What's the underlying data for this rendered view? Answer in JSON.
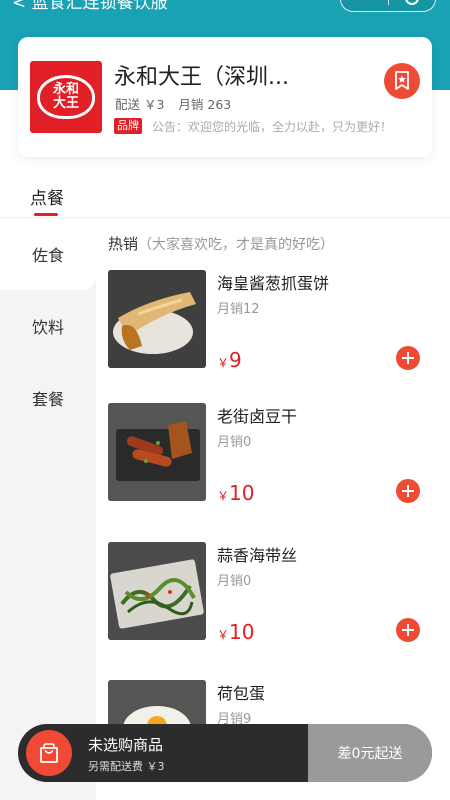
{
  "header": {
    "title": "< 蓝食汇连锁餐饮服"
  },
  "store": {
    "name": "永和大王（深圳...",
    "logo_text_top": "永和",
    "logo_text_bottom": "大王",
    "delivery": "配送 ￥3",
    "monthly_sales": "月销 263",
    "brand_tag": "品牌",
    "notice": "公告：欢迎您的光临，全力以赴，只为更好！"
  },
  "tabs": {
    "order": "点餐"
  },
  "categories": [
    "佐食",
    "饮料",
    "套餐"
  ],
  "section": {
    "title": "热销",
    "subtitle": "（大家喜欢吃，才是真的好吃）"
  },
  "products": [
    {
      "name": "海皇酱葱抓蛋饼",
      "sales": "月销12",
      "currency": "￥",
      "price": "9"
    },
    {
      "name": "老街卤豆干",
      "sales": "月销0",
      "currency": "￥",
      "price": "10"
    },
    {
      "name": "蒜香海带丝",
      "sales": "月销0",
      "currency": "￥",
      "price": "10"
    },
    {
      "name": "荷包蛋",
      "sales": "月销9",
      "currency": "￥",
      "price": ""
    }
  ],
  "cart": {
    "empty_text": "未选购商品",
    "delivery_fee": "另需配送费 ￥3",
    "min_order": "差0元起送"
  },
  "colors": {
    "accent": "#e01f26",
    "teal": "#18a2b3",
    "button": "#ef4a34"
  }
}
